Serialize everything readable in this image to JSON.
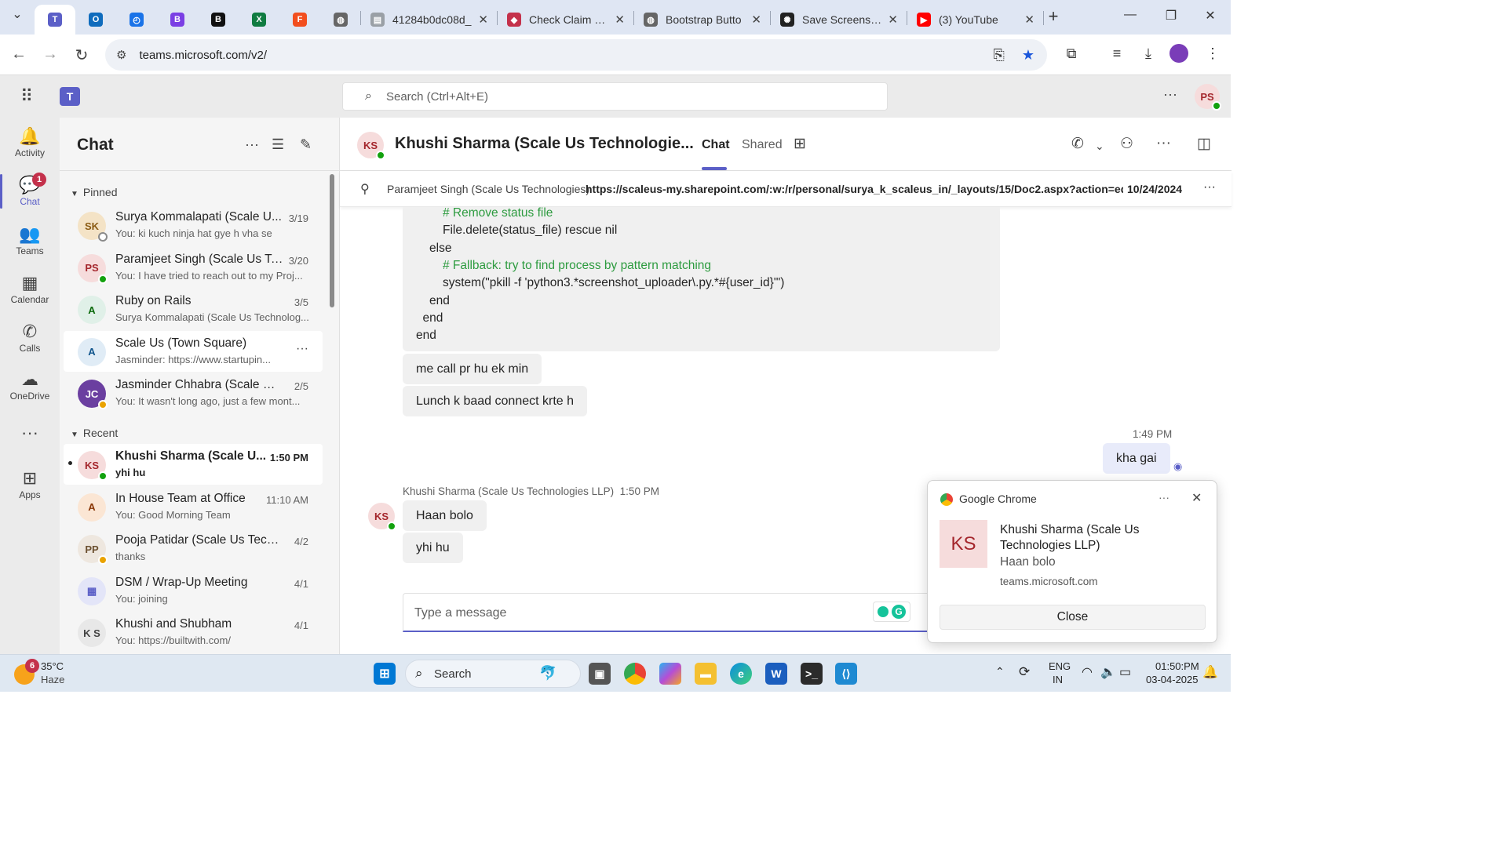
{
  "browser": {
    "tabs": [
      {
        "label": "",
        "icon": "teams-icon",
        "pinned": true,
        "active": true
      },
      {
        "label": "",
        "icon": "outlook-icon",
        "pinned": true
      },
      {
        "label": "",
        "icon": "timer-icon",
        "pinned": true
      },
      {
        "label": "",
        "icon": "b-purple-icon",
        "pinned": true
      },
      {
        "label": "",
        "icon": "b-black-icon",
        "pinned": true
      },
      {
        "label": "",
        "icon": "excel-icon",
        "pinned": true
      },
      {
        "label": "",
        "icon": "figma-icon",
        "pinned": true
      },
      {
        "label": "",
        "icon": "globe-icon",
        "pinned": true
      },
      {
        "label": "41284b0dc08d_",
        "icon": "file-icon"
      },
      {
        "label": "Check Claim Sta",
        "icon": "claim-icon"
      },
      {
        "label": "Bootstrap Butto",
        "icon": "globe-icon"
      },
      {
        "label": "Save Screenshot",
        "icon": "openai-icon"
      },
      {
        "label": "(3) YouTube",
        "icon": "youtube-icon"
      }
    ],
    "new_tab_label": "+",
    "url": "teams.microsoft.com/v2/"
  },
  "teams": {
    "search_placeholder": "Search (Ctrl+Alt+E)",
    "profile_initials": "PS",
    "rail": [
      {
        "label": "Activity",
        "icon": "bell-icon"
      },
      {
        "label": "Chat",
        "icon": "chat-icon",
        "active": true,
        "badge": "1"
      },
      {
        "label": "Teams",
        "icon": "teams-people-icon"
      },
      {
        "label": "Calendar",
        "icon": "calendar-icon"
      },
      {
        "label": "Calls",
        "icon": "phone-icon"
      },
      {
        "label": "OneDrive",
        "icon": "cloud-icon"
      },
      {
        "label": "",
        "icon": "more-icon"
      },
      {
        "label": "Apps",
        "icon": "apps-add-icon"
      }
    ]
  },
  "chatlist": {
    "title": "Chat",
    "pinned_label": "Pinned",
    "recent_label": "Recent",
    "pinned": [
      {
        "name": "Surya Kommalapati (Scale U...",
        "preview": "You: ki kuch ninja hat gye h vha se",
        "date": "3/19",
        "initials": "SK",
        "bg": "#f4e3c6",
        "fg": "#8a5a12",
        "status": "grey"
      },
      {
        "name": "Paramjeet Singh (Scale Us Te...",
        "preview": "You: I have tried to reach out to my Proj...",
        "date": "3/20",
        "initials": "PS",
        "bg": "#f6dcdc",
        "fg": "#a4262c",
        "status": "green"
      },
      {
        "name": "Ruby on Rails",
        "preview": "Surya Kommalapati (Scale Us Technolog...",
        "date": "3/5",
        "initials": "A",
        "bg": "#e0f0e8",
        "fg": "#0b6a0b",
        "status": "group"
      },
      {
        "name": "Scale Us (Town Square)",
        "preview": "Jasminder: https://www.startupin...",
        "date": "",
        "initials": "A",
        "bg": "#e0ecf6",
        "fg": "#0f548c",
        "status": "group",
        "hover": true
      },
      {
        "name": "Jasminder Chhabra (Scale Us ...",
        "preview": "You: It wasn't long ago, just a few mont...",
        "date": "2/5",
        "initials": "JC",
        "bg": "#6b3fa0",
        "fg": "#ffffff",
        "status": "amber"
      }
    ],
    "recent": [
      {
        "name": "Khushi Sharma (Scale U...",
        "preview": "yhi hu",
        "date": "1:50 PM",
        "initials": "KS",
        "bg": "#f6dcdc",
        "fg": "#a4262c",
        "status": "green",
        "selected": true,
        "unread": true
      },
      {
        "name": "In House Team at Office",
        "preview": "You: Good Morning Team",
        "date": "11:10 AM",
        "initials": "A",
        "bg": "#fbe6d4",
        "fg": "#8a3707",
        "status": "group"
      },
      {
        "name": "Pooja Patidar (Scale Us Techn...",
        "preview": "thanks",
        "date": "4/2",
        "initials": "PP",
        "bg": "#eee7df",
        "fg": "#6b4f2f",
        "status": "amber"
      },
      {
        "name": "DSM / Wrap-Up Meeting",
        "preview": "You: joining",
        "date": "4/1",
        "initials": "▦",
        "bg": "#e3e5f8",
        "fg": "#5b5fc7",
        "status": "none"
      },
      {
        "name": "Khushi and Shubham",
        "preview": "You: https://builtwith.com/",
        "date": "4/1",
        "initials": "K S",
        "bg": "#e8e8e8",
        "fg": "#424242",
        "status": "none"
      }
    ]
  },
  "conversation": {
    "title": "Khushi Sharma (Scale Us Technologie...",
    "initials": "KS",
    "tab_chat": "Chat",
    "tab_shared": "Shared",
    "pinned_bar": {
      "author": "Paramjeet Singh (Scale Us Technologies)",
      "link": "https://scaleus-my.sharepoint.com/:w:/r/personal/surya_k_scaleus_in/_layouts/15/Doc2.aspx?action=edit&sourc...",
      "date": "10/24/2024"
    },
    "code_lines": [
      {
        "text": "# Remove status file",
        "comment": true,
        "indent": 2
      },
      {
        "text": "File.delete(status_file) rescue nil",
        "comment": false,
        "indent": 2
      },
      {
        "text": "else",
        "comment": false,
        "indent": 1
      },
      {
        "text": "# Fallback: try to find process by pattern matching",
        "comment": true,
        "indent": 2
      },
      {
        "text": "system(\"pkill -f 'python3.*screenshot_uploader\\.py.*#{user_id}'\")",
        "comment": false,
        "indent": 2
      },
      {
        "text": "end",
        "comment": false,
        "indent": 1
      },
      {
        "text": "end",
        "comment": false,
        "indent": 0.5
      },
      {
        "text": "end",
        "comment": false,
        "indent": 0
      }
    ],
    "msg_call": "me call pr hu ek min",
    "msg_lunch": "Lunch k baad connect krte  h",
    "my_time": "1:49 PM",
    "my_msg": "kha gai",
    "sender_line_name": "Khushi Sharma (Scale Us Technologies LLP)",
    "sender_line_time": "1:50 PM",
    "msg_haan": "Haan bolo",
    "msg_yhi": "yhi hu",
    "compose_placeholder": "Type a message"
  },
  "notification": {
    "app": "Google Chrome",
    "initials": "KS",
    "title": "Khushi Sharma (Scale Us Technologies LLP)",
    "body": "Haan bolo",
    "source": "teams.microsoft.com",
    "close_label": "Close"
  },
  "taskbar": {
    "weather_temp": "35°C",
    "weather_desc": "Haze",
    "weather_badge": "6",
    "search_label": "Search",
    "lang1": "ENG",
    "lang2": "IN",
    "time": "01:50:PM",
    "date": "03-04-2025"
  },
  "colors": {
    "accent": "#5b5fc7",
    "presence_green": "#13a10e",
    "code_comment": "#2d9b3f"
  }
}
